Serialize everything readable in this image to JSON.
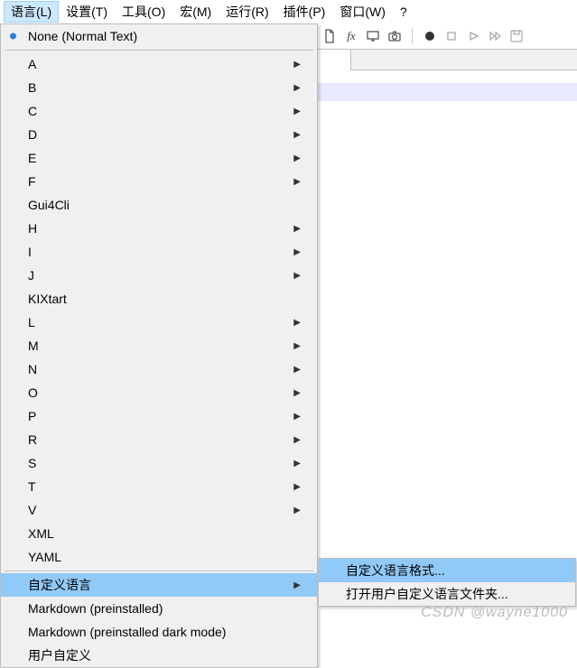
{
  "menubar": {
    "items": [
      {
        "label": "语言(L)",
        "active": true
      },
      {
        "label": "设置(T)"
      },
      {
        "label": "工具(O)"
      },
      {
        "label": "宏(M)"
      },
      {
        "label": "运行(R)"
      },
      {
        "label": "插件(P)"
      },
      {
        "label": "窗口(W)"
      },
      {
        "label": "?"
      }
    ]
  },
  "toolbar_icons": [
    "file-icon",
    "fx-icon",
    "monitor-icon",
    "camera-icon",
    "sep",
    "record-icon",
    "stop-icon",
    "play-icon",
    "ff-icon",
    "save-macro-icon"
  ],
  "dropdown": {
    "groups": [
      {
        "items": [
          {
            "label": "None (Normal Text)",
            "bullet": true,
            "arrow": false
          }
        ]
      },
      {
        "items": [
          {
            "label": "A",
            "arrow": true
          },
          {
            "label": "B",
            "arrow": true
          },
          {
            "label": "C",
            "arrow": true
          },
          {
            "label": "D",
            "arrow": true
          },
          {
            "label": "E",
            "arrow": true
          },
          {
            "label": "F",
            "arrow": true
          },
          {
            "label": "Gui4Cli",
            "arrow": false
          },
          {
            "label": "H",
            "arrow": true
          },
          {
            "label": "I",
            "arrow": true
          },
          {
            "label": "J",
            "arrow": true
          },
          {
            "label": "KIXtart",
            "arrow": false
          },
          {
            "label": "L",
            "arrow": true
          },
          {
            "label": "M",
            "arrow": true
          },
          {
            "label": "N",
            "arrow": true
          },
          {
            "label": "O",
            "arrow": true
          },
          {
            "label": "P",
            "arrow": true
          },
          {
            "label": "R",
            "arrow": true
          },
          {
            "label": "S",
            "arrow": true
          },
          {
            "label": "T",
            "arrow": true
          },
          {
            "label": "V",
            "arrow": true
          },
          {
            "label": "XML",
            "arrow": false
          },
          {
            "label": "YAML",
            "arrow": false
          }
        ]
      },
      {
        "items": [
          {
            "label": "自定义语言",
            "arrow": true,
            "hover": true
          },
          {
            "label": "Markdown (preinstalled)",
            "arrow": false
          },
          {
            "label": "Markdown (preinstalled dark mode)",
            "arrow": false
          },
          {
            "label": "用户自定义",
            "arrow": false
          }
        ]
      }
    ]
  },
  "submenu": {
    "items": [
      {
        "label": "自定义语言格式...",
        "hover": true
      },
      {
        "label": "打开用户自定义语言文件夹..."
      }
    ]
  },
  "watermark": "CSDN @wayne1000"
}
